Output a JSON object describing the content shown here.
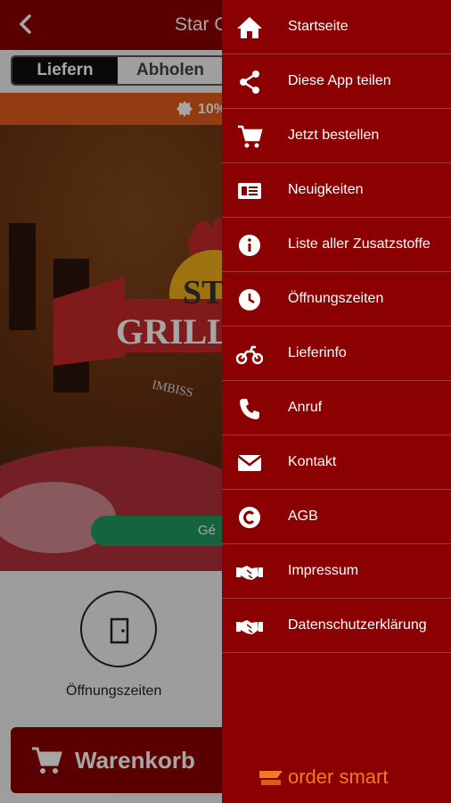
{
  "app": {
    "title": "Star G",
    "tabs": {
      "deliver": "Liefern",
      "pickup": "Abholen"
    },
    "promo_text": "10%",
    "open_button": "Gé",
    "hours_label": "Öffnungszeiten",
    "cart_label": "Warenkorb"
  },
  "drawer": {
    "items": [
      {
        "label": "Startseite",
        "icon": "home-icon"
      },
      {
        "label": "Diese App teilen",
        "icon": "share-icon"
      },
      {
        "label": "Jetzt bestellen",
        "icon": "cart-icon"
      },
      {
        "label": "Neuigkeiten",
        "icon": "news-icon"
      },
      {
        "label": "Liste aller Zusatzstoffe",
        "icon": "info-icon"
      },
      {
        "label": "Öffnungszeiten",
        "icon": "clock-icon"
      },
      {
        "label": "Lieferinfo",
        "icon": "motorbike-icon"
      },
      {
        "label": "Anruf",
        "icon": "phone-icon"
      },
      {
        "label": "Kontakt",
        "icon": "mail-icon"
      },
      {
        "label": "AGB",
        "icon": "copyright-icon"
      },
      {
        "label": "Impressum",
        "icon": "handshake-icon"
      },
      {
        "label": "Datenschutzerklärung",
        "icon": "handshake-icon"
      }
    ],
    "brand": "order smart"
  },
  "colors": {
    "primary": "#8b0000",
    "promo": "#e25c1b",
    "accent_green": "#1f9a61",
    "brand_orange": "#f07c22"
  }
}
